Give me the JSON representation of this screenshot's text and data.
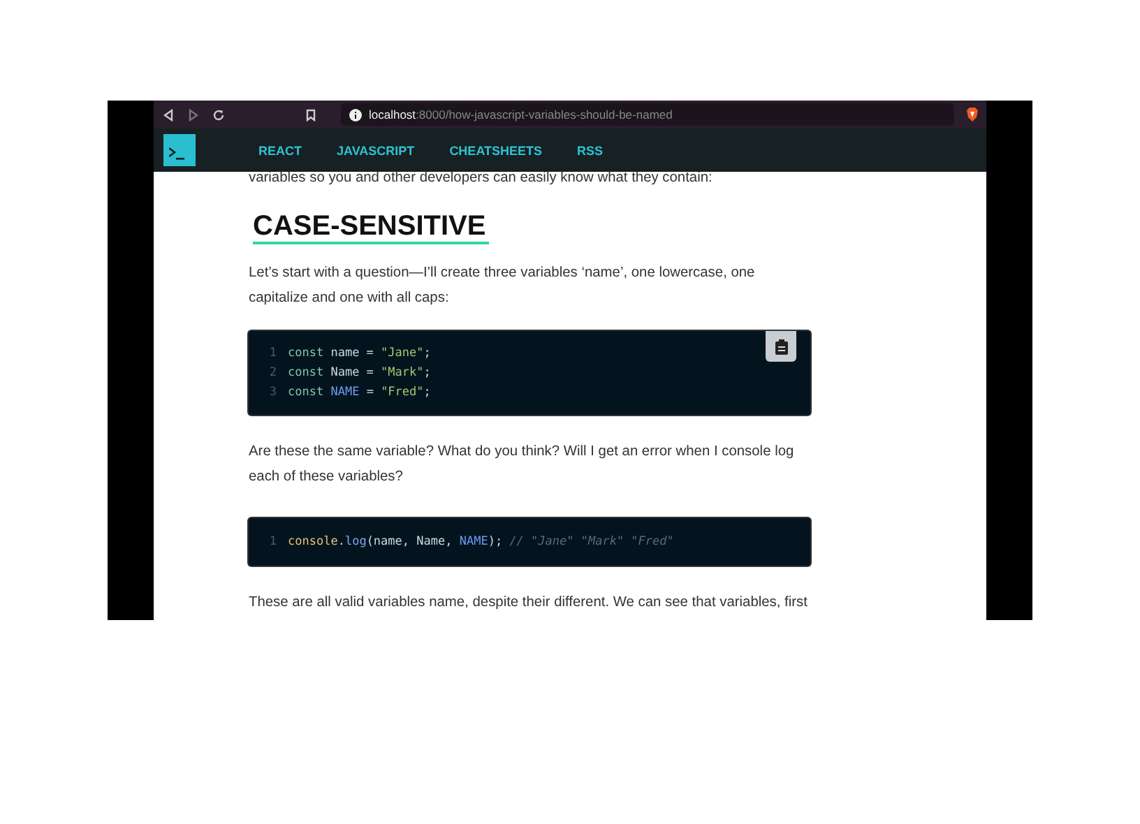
{
  "browser": {
    "url_host": "localhost",
    "url_path": ":8000/how-javascript-variables-should-be-named"
  },
  "nav": {
    "items": [
      "REACT",
      "JAVASCRIPT",
      "CHEATSHEETS",
      "RSS"
    ]
  },
  "article": {
    "blocks": [
      {
        "kind": "paragraph",
        "text": "variables so you and other developers can easily know what they contain:"
      },
      {
        "kind": "heading",
        "text": "CASE-SENSITIVE"
      },
      {
        "kind": "paragraph",
        "text": "Let’s start with a question—I’ll create three variables ‘name’, one lowercase, one capitalize and one with all caps:"
      },
      {
        "kind": "code",
        "copy_button": true,
        "lines": [
          {
            "number": "1",
            "tokens": [
              {
                "kind": "keyword",
                "text": "const "
              },
              {
                "kind": "plain",
                "text": "name = "
              },
              {
                "kind": "string",
                "text": "\"Jane\""
              },
              {
                "kind": "plain",
                "text": ";"
              }
            ]
          },
          {
            "number": "2",
            "tokens": [
              {
                "kind": "keyword",
                "text": "const "
              },
              {
                "kind": "plain",
                "text": "Name = "
              },
              {
                "kind": "string",
                "text": "\"Mark\""
              },
              {
                "kind": "plain",
                "text": ";"
              }
            ]
          },
          {
            "number": "3",
            "tokens": [
              {
                "kind": "keyword",
                "text": "const "
              },
              {
                "kind": "constant",
                "text": "NAME"
              },
              {
                "kind": "plain",
                "text": " = "
              },
              {
                "kind": "string",
                "text": "\"Fred\""
              },
              {
                "kind": "plain",
                "text": ";"
              }
            ]
          }
        ]
      },
      {
        "kind": "paragraph",
        "text": "Are these the same variable? What do you think? Will I get an error when I console log each of these variables?"
      },
      {
        "kind": "code",
        "copy_button": false,
        "lines": [
          {
            "number": "1",
            "tokens": [
              {
                "kind": "object",
                "text": "console"
              },
              {
                "kind": "plain",
                "text": "."
              },
              {
                "kind": "function",
                "text": "log"
              },
              {
                "kind": "plain",
                "text": "(name, Name, "
              },
              {
                "kind": "constant",
                "text": "NAME"
              },
              {
                "kind": "plain",
                "text": "); "
              },
              {
                "kind": "comment",
                "text": "// \"Jane\" \"Mark\" \"Fred\""
              }
            ]
          }
        ]
      },
      {
        "kind": "paragraph",
        "text": "These are all valid variables name, despite their different. We can see that variables, first"
      }
    ]
  }
}
